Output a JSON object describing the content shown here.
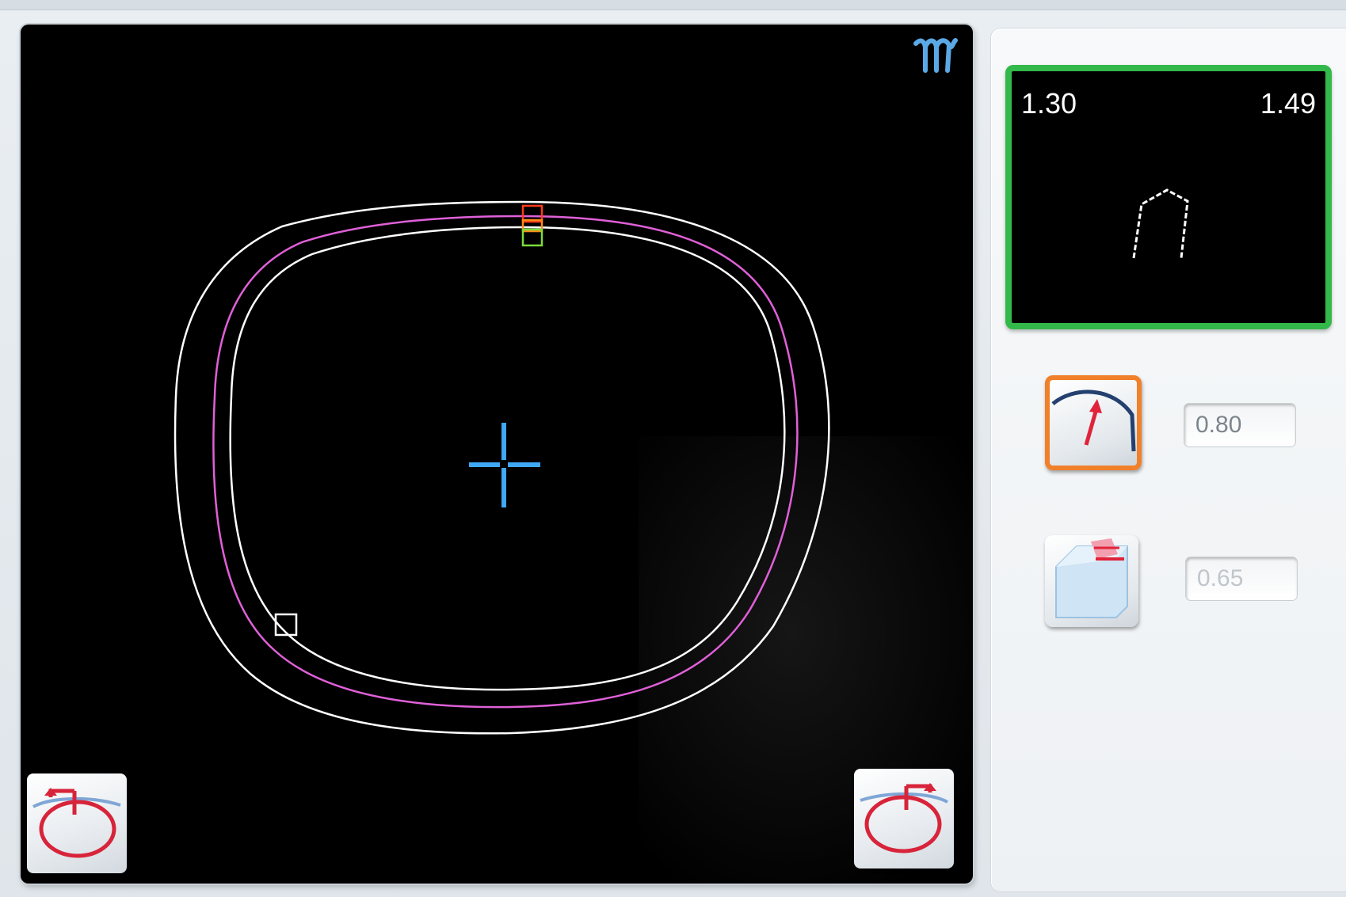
{
  "profile": {
    "left_value": "1.30",
    "right_value": "1.49"
  },
  "radius": {
    "value": "0.80"
  },
  "chamfer": {
    "value": "0.65"
  },
  "icons": {
    "logo": "brand-logo-icon",
    "rotate_left": "rotate-left-icon",
    "rotate_right": "rotate-right-icon",
    "radius": "radius-gauge-icon",
    "chamfer": "chamfer-block-icon",
    "center": "crosshair-icon"
  },
  "colors": {
    "canvas_bg": "#000000",
    "profile_border_selected": "#33b84a",
    "radius_button_border": "#f0802a",
    "contour": "#ffffff",
    "bevel_line": "#e060d8",
    "crosshair": "#3fa9f5",
    "marker_red": "#ff3b1a",
    "marker_green": "#7bdc3a"
  }
}
